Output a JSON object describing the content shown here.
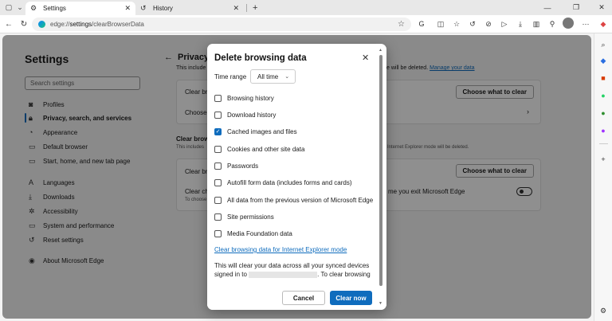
{
  "tabs": [
    {
      "label": "Settings",
      "icon": "gear-icon",
      "active": true
    },
    {
      "label": "History",
      "icon": "history-icon",
      "active": false
    }
  ],
  "address": {
    "scheme": "edge://",
    "host": "settings",
    "path": "/clearBrowserData"
  },
  "settings": {
    "title": "Settings",
    "search_placeholder": "Search settings",
    "nav": [
      {
        "label": "Profiles",
        "icon": "profile-icon"
      },
      {
        "label": "Privacy, search, and services",
        "icon": "lock-icon",
        "active": true
      },
      {
        "label": "Appearance",
        "icon": "appearance-icon"
      },
      {
        "label": "Default browser",
        "icon": "browser-icon"
      },
      {
        "label": "Start, home, and new tab page",
        "icon": "home-icon"
      },
      {
        "label": "Languages",
        "icon": "languages-icon"
      },
      {
        "label": "Downloads",
        "icon": "download-icon"
      },
      {
        "label": "Accessibility",
        "icon": "accessibility-icon"
      },
      {
        "label": "System and performance",
        "icon": "system-icon"
      },
      {
        "label": "Reset settings",
        "icon": "reset-icon"
      },
      {
        "label": "About Microsoft Edge",
        "icon": "edge-logo-icon"
      }
    ]
  },
  "privacy": {
    "title": "Privacy,",
    "intro_prefix": "This include",
    "intro_suffix": "e will be deleted.",
    "manage_link": "Manage your data",
    "card1_row1": "Clear bro",
    "card1_row2": "Choose w",
    "choose_btn": "Choose what to clear",
    "section2_title": "Clear brow",
    "section2_sub_prefix": "This includes",
    "section2_sub_suffix": "Internet Explorer mode will be deleted.",
    "card2_row1": "Clear bro",
    "card2_row2": "Clear cho",
    "card2_row2_suffix": "me you exit Microsoft Edge",
    "card2_row3": "To choose"
  },
  "dialog": {
    "title": "Delete browsing data",
    "time_range_label": "Time range",
    "time_range_value": "All time",
    "options": [
      {
        "label": "Browsing history",
        "checked": false
      },
      {
        "label": "Download history",
        "checked": false
      },
      {
        "label": "Cached images and files",
        "checked": true
      },
      {
        "label": "Cookies and other site data",
        "checked": false
      },
      {
        "label": "Passwords",
        "checked": false
      },
      {
        "label": "Autofill form data (includes forms and cards)",
        "checked": false
      },
      {
        "label": "All data from the previous version of Microsoft Edge",
        "checked": false
      },
      {
        "label": "Site permissions",
        "checked": false
      },
      {
        "label": "Media Foundation data",
        "checked": false
      }
    ],
    "ie_link": "Clear browsing data for Internet Explorer mode",
    "sync_text_1": "This will clear your data across all your synced devices",
    "sync_text_2": "signed in to",
    "sync_text_3": ". To clear browsing",
    "cancel": "Cancel",
    "clear_now": "Clear now"
  }
}
